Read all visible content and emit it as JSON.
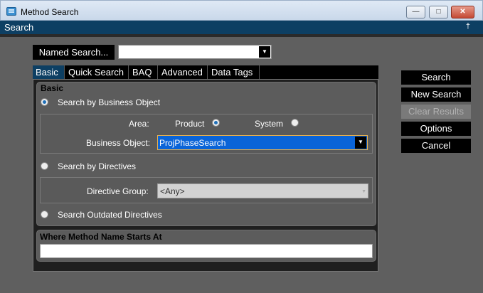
{
  "window": {
    "title": "Method Search"
  },
  "searchbar": {
    "label": "Search",
    "pin_glyph": "↕"
  },
  "named_search": {
    "label": "Named Search...",
    "value": ""
  },
  "tabs": [
    {
      "label": "Basic",
      "active": true
    },
    {
      "label": "Quick Search",
      "active": false
    },
    {
      "label": "BAQ",
      "active": false
    },
    {
      "label": "Advanced",
      "active": false
    },
    {
      "label": "Data Tags",
      "active": false
    }
  ],
  "basic": {
    "heading": "Basic",
    "opt_business_object": {
      "label": "Search by Business Object",
      "checked": true
    },
    "area_label": "Area:",
    "area_product": {
      "label": "Product",
      "checked": true
    },
    "area_system": {
      "label": "System",
      "checked": false
    },
    "business_object_label": "Business Object:",
    "business_object_value": "ProjPhaseSearch",
    "opt_directives": {
      "label": "Search by Directives",
      "checked": false
    },
    "directive_group_label": "Directive Group:",
    "directive_group_value": "<Any>",
    "opt_outdated": {
      "label": "Search Outdated Directives",
      "checked": false
    }
  },
  "where": {
    "heading": "Where Method Name Starts At",
    "value": ""
  },
  "buttons": {
    "search": "Search",
    "new_search": "New Search",
    "clear_results": "Clear Results",
    "options": "Options",
    "cancel": "Cancel"
  },
  "colors": {
    "accent": "#0d3f63",
    "selection": "#0a64d8",
    "panel": "#5c5c5c"
  }
}
